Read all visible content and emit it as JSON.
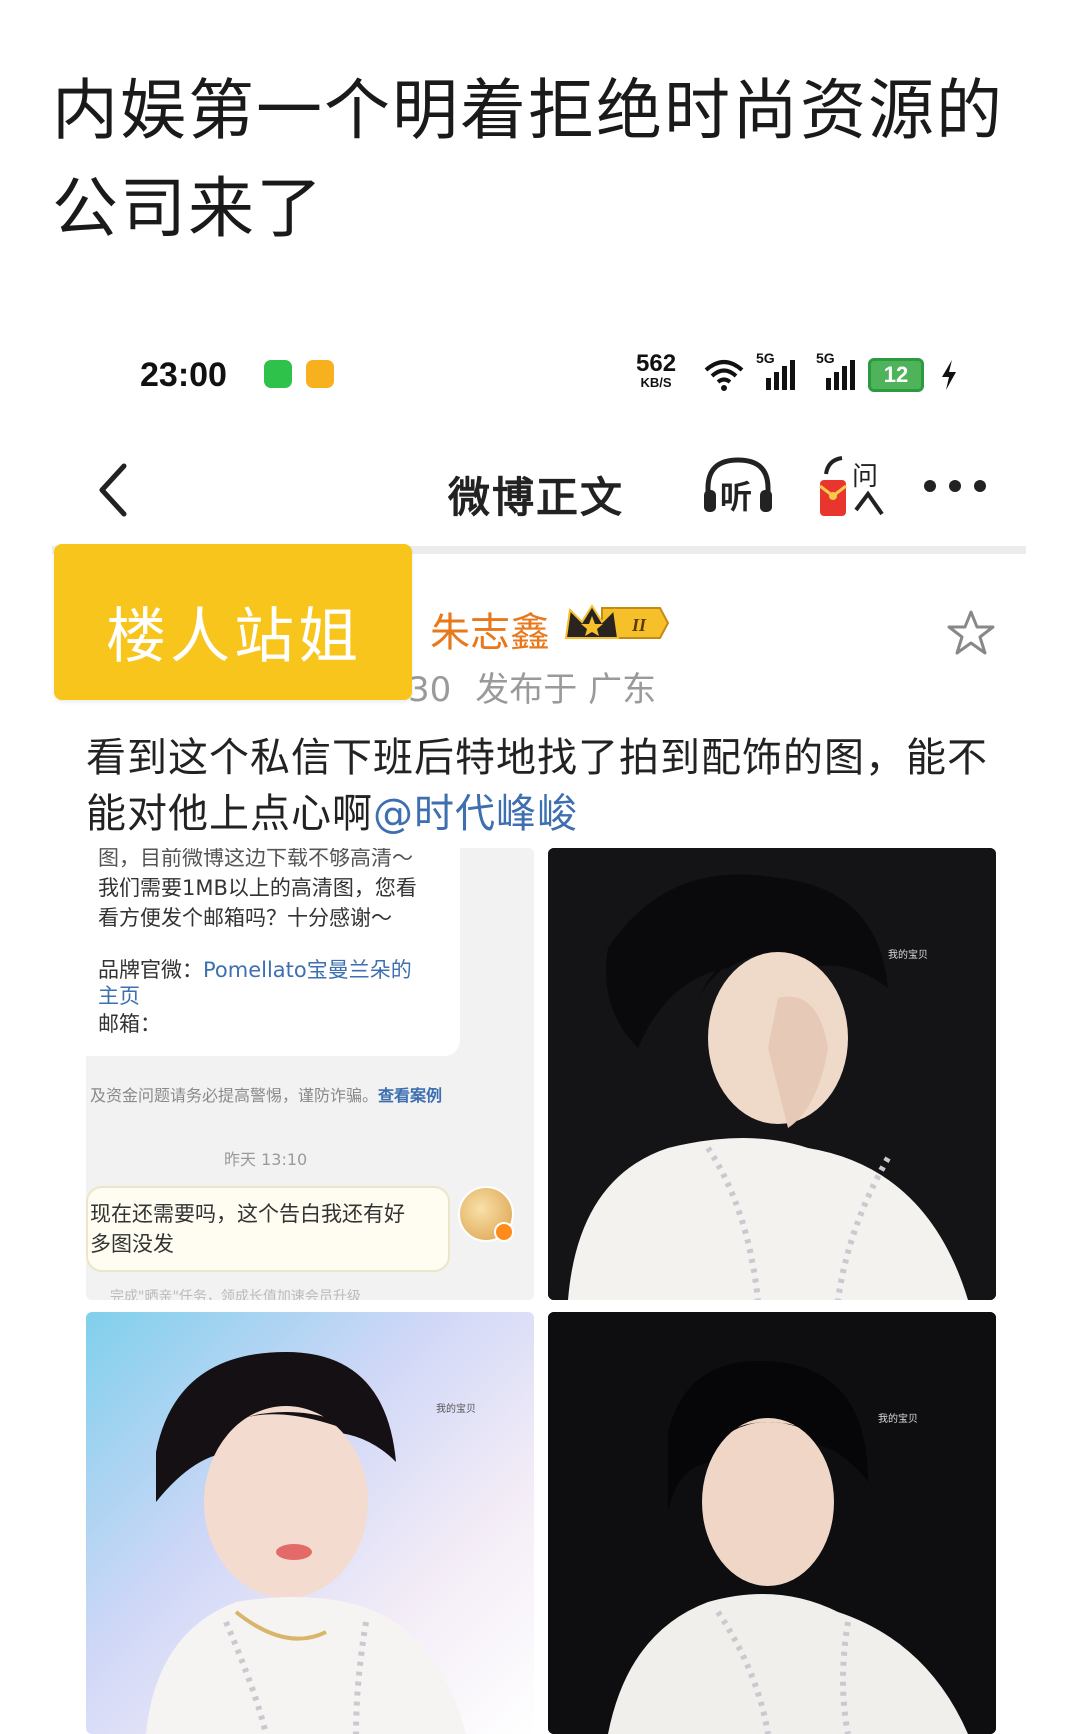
{
  "headline": {
    "line1": "内娱第一个明着拒绝时尚资源的",
    "line2": "公司来了"
  },
  "status_bar": {
    "time": "23:00",
    "speed_value": "562",
    "speed_unit": "KB/S",
    "signal1_label": "5G",
    "signal2_label": "5G",
    "battery": "12",
    "colors": {
      "app1": "#2fc24a",
      "app2": "#f7b11e",
      "battery": "#4fb35c"
    }
  },
  "nav": {
    "title": "微博正文",
    "listen_label": "听",
    "ask_label": "问"
  },
  "overlay_tag": {
    "label": "楼人站姐",
    "color": "#f8c51d"
  },
  "post": {
    "author": "朱志鑫",
    "vip_level": "II",
    "time_fragment": "30",
    "location": "发布于 广东",
    "text_line1": "看到这个私信下班后特地找了拍到配饰的图，能不",
    "text_line2": "能对他上点心啊",
    "mention": "@时代峰峻",
    "colors": {
      "author": "#e8781a",
      "mention": "#3e6fb0"
    }
  },
  "chat_screenshot": {
    "line_cut": "图，目前微博这边下载不够高清～",
    "line1": "我们需要1MB以上的高清图，您看",
    "line2": "看方便发个邮箱吗？十分感谢～",
    "brand_label": "品牌官微：",
    "brand_link": "Pomellato宝曼兰朵的",
    "brand_link2": "主页",
    "email_label": "邮箱：",
    "warning": "及资金问题请务必提高警惕，谨防诈骗。",
    "warning_link": "查看案例",
    "timestamp": "昨天 13:10",
    "reply_line1": "现在还需要吗，这个告白我还有好",
    "reply_line2": "多图没发",
    "bottom_cut": "完成\"晒亲\"任务，领成长值加速会员升级"
  },
  "photos": {
    "watermark": "我的宝贝"
  }
}
